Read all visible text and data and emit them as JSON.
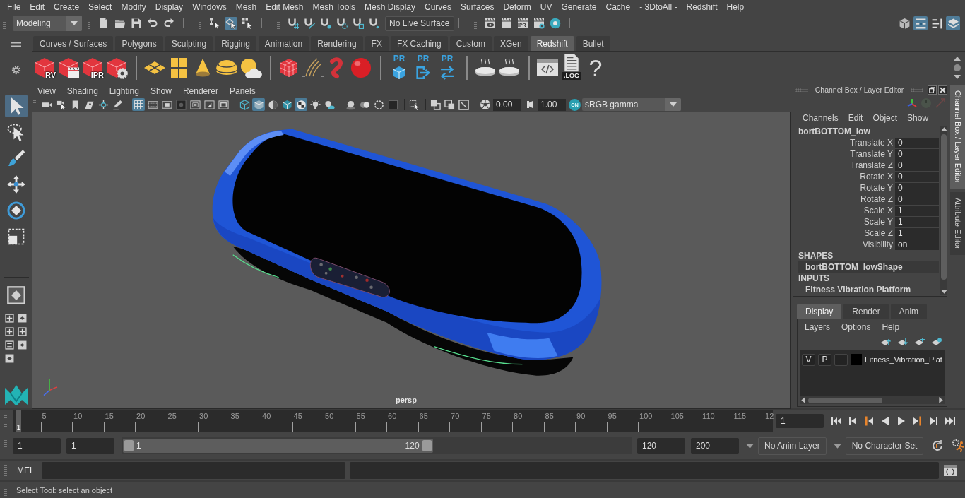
{
  "menu_bar": [
    "File",
    "Edit",
    "Create",
    "Select",
    "Modify",
    "Display",
    "Windows",
    "Mesh",
    "Edit Mesh",
    "Mesh Tools",
    "Mesh Display",
    "Curves",
    "Surfaces",
    "Deform",
    "UV",
    "Generate",
    "Cache",
    "- 3DtoAll -",
    "Redshift",
    "Help"
  ],
  "status_line": {
    "menu_set": "Modeling",
    "file_tools": [
      {
        "kind": "page"
      },
      {
        "kind": "folder"
      },
      {
        "kind": "disk"
      },
      {
        "kind": "undo"
      },
      {
        "kind": "redo"
      }
    ],
    "select_modes": [
      {
        "kind": "hierarchy",
        "selected": false
      },
      {
        "kind": "object",
        "selected": true
      },
      {
        "kind": "component",
        "selected": false
      }
    ],
    "snap_tools": [
      {
        "kind": "snapgrid"
      },
      {
        "kind": "snapcurve"
      },
      {
        "kind": "snappoint"
      },
      {
        "kind": "snapplane"
      },
      {
        "kind": "snaplive"
      },
      {
        "kind": "magnet"
      }
    ],
    "live_surface": "No Live Surface",
    "render_tools": [
      {
        "kind": "renderview"
      },
      {
        "kind": "render"
      },
      {
        "kind": "ipr",
        "label": "IPR"
      },
      {
        "kind": "rendersettings"
      },
      {
        "kind": "hypershade"
      }
    ],
    "panel_toggles": [
      {
        "kind": "toolkit",
        "on": false
      },
      {
        "kind": "attributes",
        "on": true
      },
      {
        "kind": "toolsettings",
        "on": false
      },
      {
        "kind": "channels",
        "on": true
      }
    ]
  },
  "shelf": {
    "tabs": [
      {
        "label": "Curves / Surfaces",
        "selected": false
      },
      {
        "label": "Polygons",
        "selected": false
      },
      {
        "label": "Sculpting",
        "selected": false
      },
      {
        "label": "Rigging",
        "selected": false
      },
      {
        "label": "Animation",
        "selected": false
      },
      {
        "label": "Rendering",
        "selected": false
      },
      {
        "label": "FX",
        "selected": false
      },
      {
        "label": "FX Caching",
        "selected": false
      },
      {
        "label": "Custom",
        "selected": false
      },
      {
        "label": "XGen",
        "selected": false
      },
      {
        "label": "Redshift",
        "selected": true
      },
      {
        "label": "Bullet",
        "selected": false
      }
    ],
    "groups": [
      [
        {
          "kind": "rscube",
          "label": "RV"
        },
        {
          "kind": "rsclapper"
        },
        {
          "kind": "rscube",
          "label": "IPR"
        },
        {
          "kind": "rsgear"
        }
      ],
      [
        {
          "kind": "diamonds"
        },
        {
          "kind": "panels"
        },
        {
          "kind": "cone"
        },
        {
          "kind": "dome"
        },
        {
          "kind": "suncloud"
        }
      ],
      [
        {
          "kind": "redgrid"
        },
        {
          "kind": "strands"
        },
        {
          "kind": "worm"
        },
        {
          "kind": "ball"
        }
      ],
      [
        {
          "kind": "prcube",
          "label": "PR"
        },
        {
          "kind": "prexport",
          "label": "PR"
        },
        {
          "kind": "prswap",
          "label": "PR"
        }
      ],
      [
        {
          "kind": "pie"
        },
        {
          "kind": "pie"
        }
      ],
      [
        {
          "kind": "codewindow"
        },
        {
          "kind": "logfile",
          "label": ".LOG"
        },
        {
          "kind": "help",
          "label": "?"
        }
      ]
    ]
  },
  "toolbox": {
    "tools": [
      {
        "kind": "select",
        "selected": true
      },
      {
        "kind": "lasso",
        "selected": false
      },
      {
        "kind": "paint",
        "selected": false
      },
      {
        "kind": "move",
        "selected": false
      },
      {
        "kind": "rotate",
        "selected": false
      },
      {
        "kind": "scale",
        "selected": false
      }
    ],
    "layouts": [
      {
        "kind": "single"
      },
      {
        "kind": "quad"
      },
      {
        "kind": "diamond"
      },
      {
        "kind": "quad"
      },
      {
        "kind": "quad"
      },
      {
        "kind": "listing"
      },
      {
        "kind": "diamond"
      },
      {
        "kind": "diamond"
      }
    ]
  },
  "viewport": {
    "menus": [
      "View",
      "Shading",
      "Lighting",
      "Show",
      "Renderer",
      "Panels"
    ],
    "toolbar": [
      [
        {
          "kind": "camera",
          "on": false
        },
        {
          "kind": "camerapick",
          "on": false
        },
        {
          "kind": "bookmark",
          "on": false
        },
        {
          "kind": "imageplane",
          "on": false
        },
        {
          "kind": "pan",
          "on": false
        },
        {
          "kind": "pencil",
          "on": false
        }
      ],
      [
        {
          "kind": "grid",
          "on": true
        },
        {
          "kind": "filmgate",
          "on": false
        },
        {
          "kind": "resgate",
          "on": false
        },
        {
          "kind": "gatemask",
          "on": false
        },
        {
          "kind": "fieldchart",
          "on": false
        },
        {
          "kind": "safeaction",
          "on": false
        },
        {
          "kind": "safetitle",
          "on": false
        }
      ],
      [
        {
          "kind": "wirecube",
          "on": false
        },
        {
          "kind": "solidcube",
          "on": true
        },
        {
          "kind": "halfshade",
          "on": false
        },
        {
          "kind": "wireshaded",
          "on": false
        },
        {
          "kind": "checker",
          "on": true
        },
        {
          "kind": "bulb",
          "on": false
        },
        {
          "kind": "shadow",
          "on": false
        }
      ],
      [
        {
          "kind": "occlusion",
          "on": false
        },
        {
          "kind": "blur",
          "on": false
        },
        {
          "kind": "smooth",
          "on": false
        },
        {
          "kind": "focus",
          "on": false
        }
      ],
      [
        {
          "kind": "isolate",
          "on": false
        }
      ],
      [
        {
          "kind": "xray",
          "on": false
        },
        {
          "kind": "xrayjoint",
          "on": false
        },
        {
          "kind": "xraycomp",
          "on": false
        }
      ]
    ],
    "exposure": "0.00",
    "gamma": "1.00",
    "color_management": "ON",
    "view_transform": "sRGB gamma",
    "camera": "persp"
  },
  "channel_box": {
    "title": "Channel Box / Layer Editor",
    "menus": [
      "Channels",
      "Edit",
      "Object",
      "Show"
    ],
    "object": "bortBOTTOM_low",
    "attributes": [
      {
        "name": "Translate X",
        "value": "0"
      },
      {
        "name": "Translate Y",
        "value": "0"
      },
      {
        "name": "Translate Z",
        "value": "0"
      },
      {
        "name": "Rotate X",
        "value": "0"
      },
      {
        "name": "Rotate Y",
        "value": "0"
      },
      {
        "name": "Rotate Z",
        "value": "0"
      },
      {
        "name": "Scale X",
        "value": "1"
      },
      {
        "name": "Scale Y",
        "value": "1"
      },
      {
        "name": "Scale Z",
        "value": "1"
      },
      {
        "name": "Visibility",
        "value": "on"
      }
    ],
    "shapes_heading": "SHAPES",
    "shape": "bortBOTTOM_lowShape",
    "inputs_heading": "INPUTS",
    "input": "Fitness Vibration Platform"
  },
  "layer_editor": {
    "tabs": [
      {
        "label": "Display",
        "selected": true
      },
      {
        "label": "Render",
        "selected": false
      },
      {
        "label": "Anim",
        "selected": false
      }
    ],
    "menus": [
      "Layers",
      "Options",
      "Help"
    ],
    "layers": [
      {
        "visible": "V",
        "playback": "P",
        "color": "#000000",
        "name": "Fitness_Vibration_Plat"
      }
    ]
  },
  "side_tabs": [
    {
      "label": "Channel Box / Layer Editor",
      "selected": true
    },
    {
      "label": "Attribute Editor",
      "selected": false
    }
  ],
  "time_slider": {
    "ticks": [
      "5",
      "10",
      "15",
      "20",
      "25",
      "30",
      "35",
      "40",
      "45",
      "50",
      "55",
      "60",
      "65",
      "70",
      "75",
      "80",
      "85",
      "90",
      "95",
      "100",
      "105",
      "110",
      "115",
      "12"
    ],
    "current_frame": "1",
    "level": 0,
    "frame_field": "1",
    "playback": [
      {
        "kind": "start"
      },
      {
        "kind": "stepback"
      },
      {
        "kind": "keyback"
      },
      {
        "kind": "playback"
      },
      {
        "kind": "play"
      },
      {
        "kind": "keyforward"
      },
      {
        "kind": "stepforward"
      },
      {
        "kind": "end"
      }
    ]
  },
  "range_slider": {
    "start": "1",
    "playback_start": "1",
    "level": 0.61,
    "range_start": "1",
    "range_end": "120",
    "playback_end": "120",
    "end": "200",
    "anim_layer": "No Anim Layer",
    "character_set": "No Character Set"
  },
  "command_line": {
    "label": "MEL"
  },
  "help_line": "Select Tool: select an object"
}
